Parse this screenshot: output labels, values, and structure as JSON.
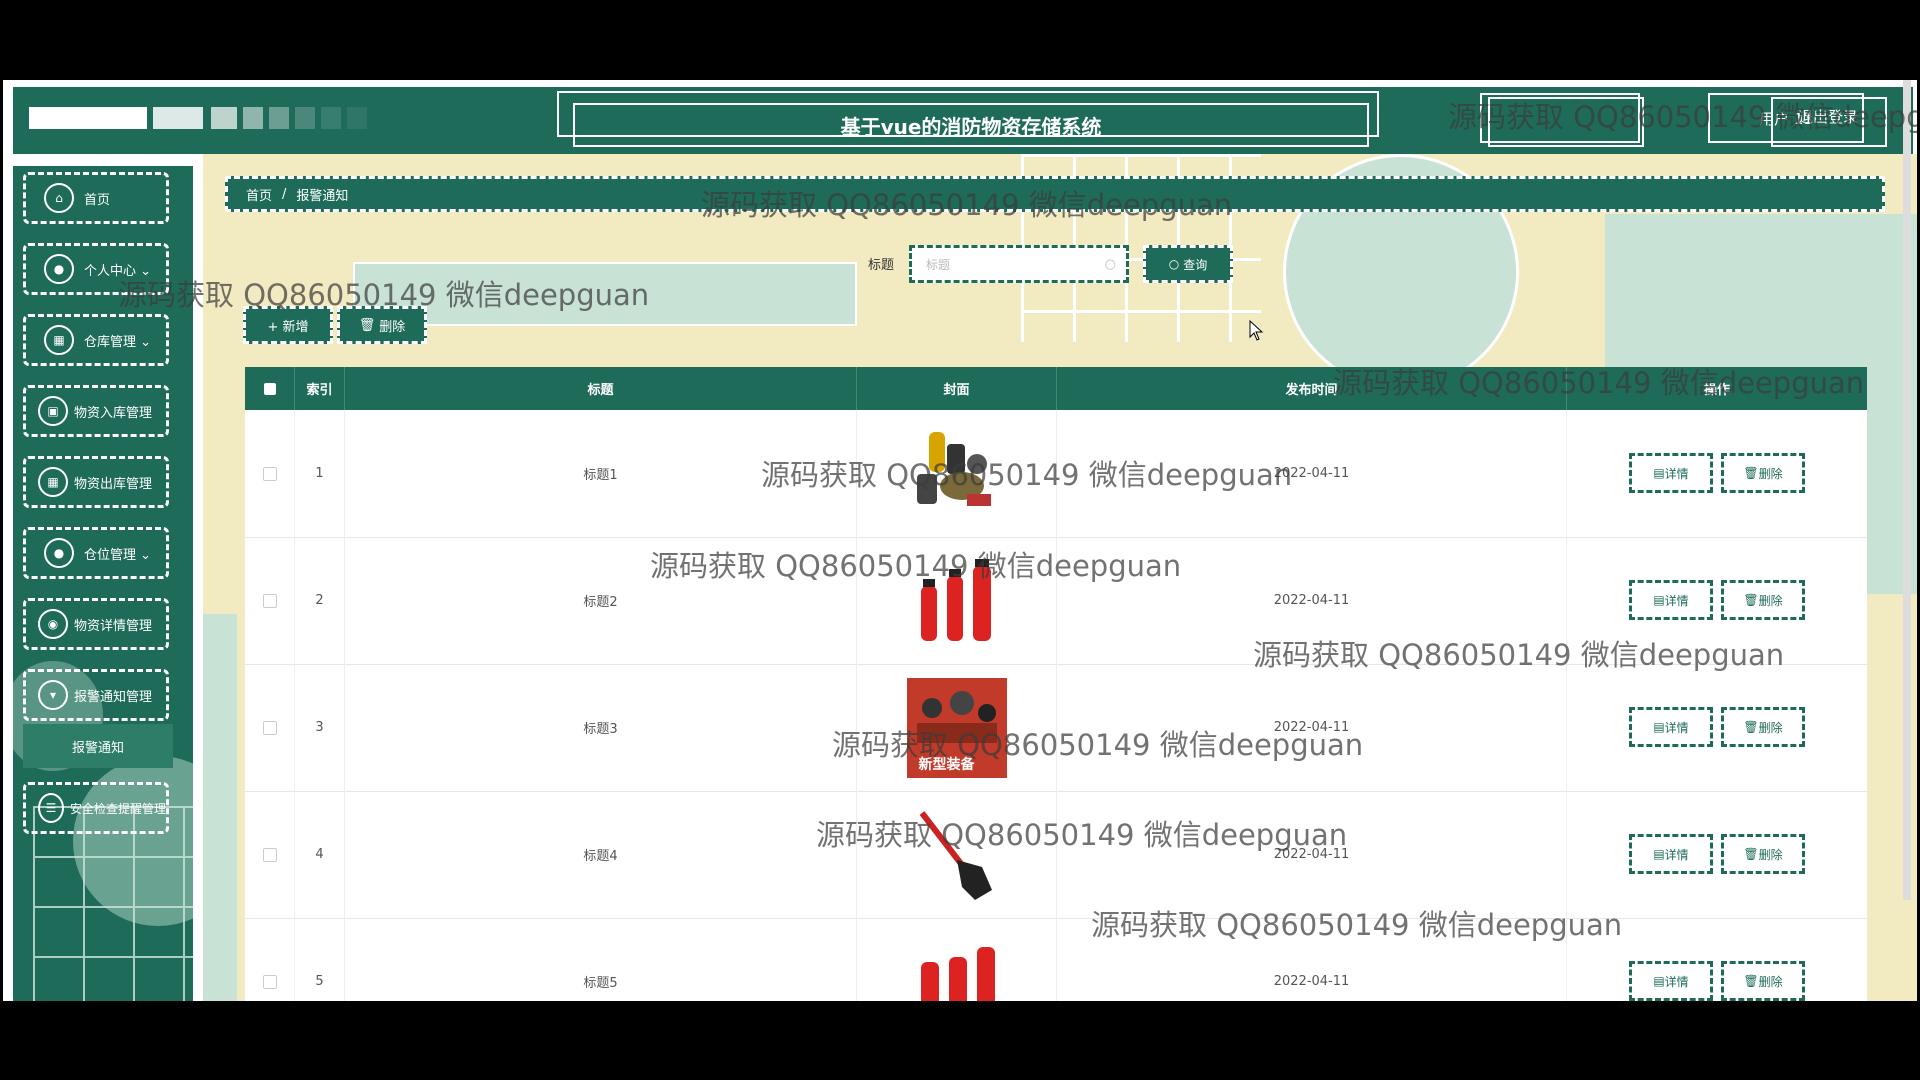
{
  "header": {
    "system_title": "基于vue的消防物资存储系统",
    "user_label": "用户 11",
    "logout_label": "退出登录"
  },
  "sidebar": {
    "items": [
      {
        "label": "首页",
        "icon": "home-icon"
      },
      {
        "label": "个人中心",
        "icon": "user-icon",
        "has_chevron": true
      },
      {
        "label": "仓库管理",
        "icon": "grid-icon",
        "has_chevron": true
      },
      {
        "label": "物资入库管理",
        "icon": "box-icon"
      },
      {
        "label": "物资出库管理",
        "icon": "grid-icon"
      },
      {
        "label": "仓位管理",
        "icon": "user-icon",
        "has_chevron": true
      },
      {
        "label": "物资详情管理",
        "icon": "pin-icon"
      },
      {
        "label": "报警通知管理",
        "icon": "bell-icon"
      },
      {
        "label": "安全检查提醒管理",
        "icon": "check-icon"
      }
    ],
    "active_submenu": "报警通知",
    "chevron": "⌄"
  },
  "breadcrumb": {
    "home": "首页",
    "separator": "/",
    "current": "报警通知"
  },
  "search": {
    "label": "标题",
    "placeholder": "标题",
    "button_label": "查询"
  },
  "actions": {
    "add_label": "+ 新增",
    "delete_label": "删除"
  },
  "table": {
    "columns": [
      "索引",
      "标题",
      "封面",
      "发布时间",
      "操作"
    ],
    "detail_label": "详情",
    "delete_label": "删除",
    "rows": [
      {
        "index": "1",
        "title": "标题1",
        "cover": "fire-gear-image",
        "date": "2022-04-11"
      },
      {
        "index": "2",
        "title": "标题2",
        "cover": "fire-extinguishers-image",
        "date": "2022-04-11"
      },
      {
        "index": "3",
        "title": "标题3",
        "cover": "new-equipment-image",
        "date": "2022-04-11",
        "cover_caption": "新型装备"
      },
      {
        "index": "4",
        "title": "标题4",
        "cover": "shovel-image",
        "date": "2022-04-11"
      },
      {
        "index": "5",
        "title": "标题5",
        "cover": "fire-extinguishers-image",
        "date": "2022-04-11"
      }
    ]
  },
  "watermark": "源码获取 QQ86050149 微信deepguan",
  "colors": {
    "primary": "#1e6b5a",
    "background_cream": "#f2ebc2",
    "pale_green": "#c9e2d6"
  }
}
